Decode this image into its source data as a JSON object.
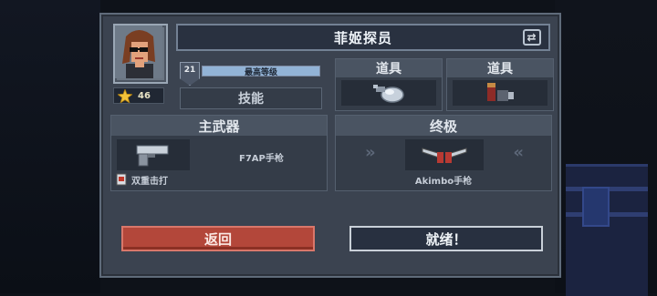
{
  "character": {
    "name": "菲姬探员",
    "stars": "46",
    "level": "21",
    "level_label": "最高等级",
    "level_progress": 1.0,
    "skill_label": "技能"
  },
  "items": [
    {
      "label": "道具",
      "icon": "grenade-icon"
    },
    {
      "label": "道具",
      "icon": "ammo-icon"
    }
  ],
  "primary": {
    "header": "主武器",
    "weapon_name": "F7AP手枪",
    "perk": "双重击打"
  },
  "ultimate": {
    "header": "终极",
    "weapon_name": "Akimbo手枪"
  },
  "buttons": {
    "back": "返回",
    "ready": "就绪！"
  },
  "colors": {
    "back_button": "#b3473a",
    "panel": "#3b4350",
    "level_fill": "#92b3d6"
  }
}
